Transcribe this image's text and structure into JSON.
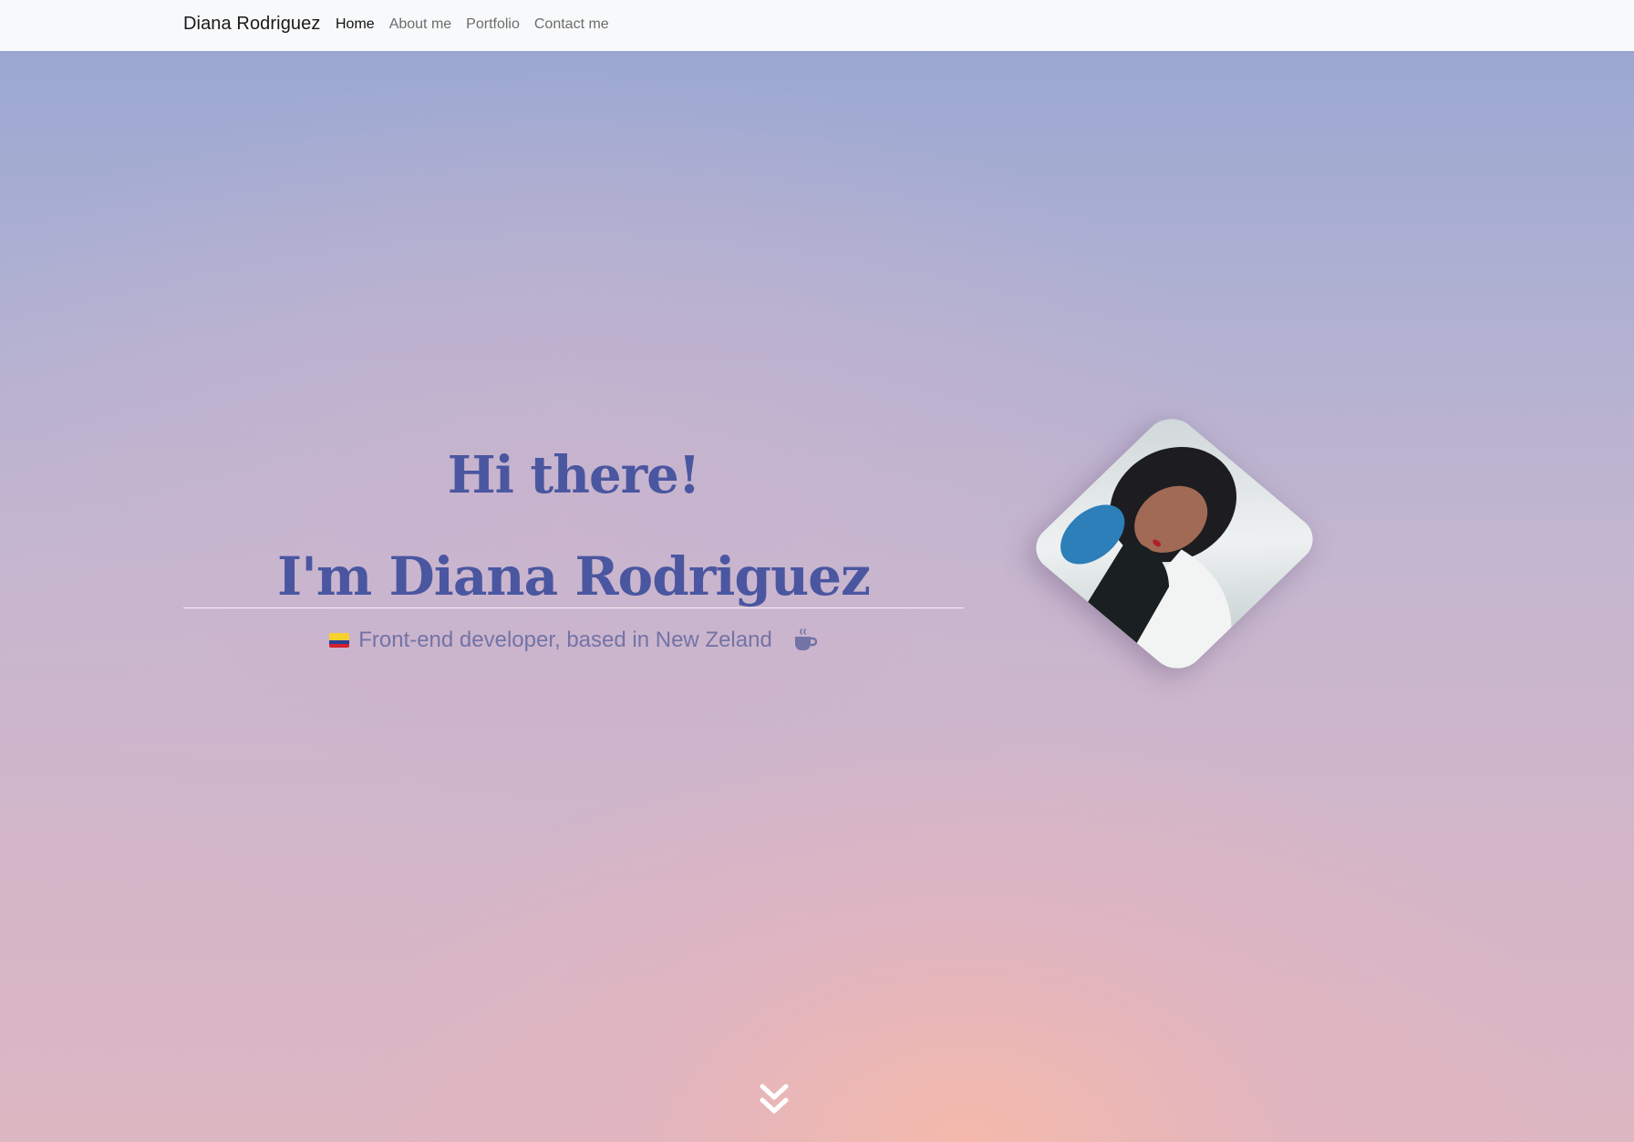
{
  "navbar": {
    "brand": "Diana Rodriguez",
    "links": [
      {
        "label": "Home",
        "active": true
      },
      {
        "label": "About me",
        "active": false
      },
      {
        "label": "Portfolio",
        "active": false
      },
      {
        "label": "Contact me",
        "active": false
      }
    ]
  },
  "hero": {
    "greeting": "Hi there!",
    "name": "I'm Diana Rodriguez",
    "tagline": "Front-end developer, based in New Zeland",
    "flag_icon": "colombia-flag-icon",
    "coffee_icon": "coffee-cup-icon",
    "title_color": "#4a56a0",
    "tagline_color": "#7473a6"
  },
  "scroll": {
    "icon": "double-chevron-down-icon"
  }
}
